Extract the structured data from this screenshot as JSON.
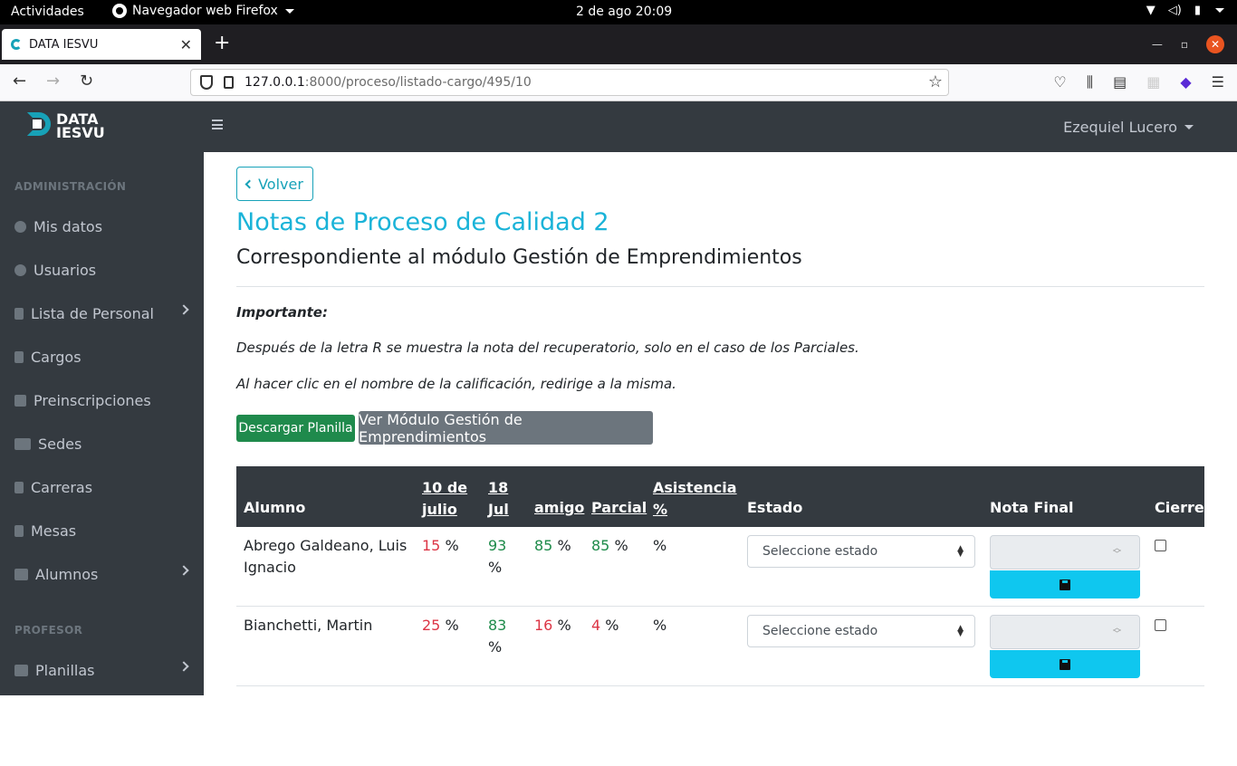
{
  "gnome": {
    "activities": "Actividades",
    "app_name": "Navegador web Firefox",
    "clock": "2 de ago  20:09"
  },
  "browser": {
    "tab_title": "DATA IESVU",
    "url_host": "127.0.0.1",
    "url_path": ":8000/proceso/listado-cargo/495/10"
  },
  "brand": {
    "line1": "DATA",
    "line2": "IESVU"
  },
  "sidebar": {
    "header_admin": "ADMINISTRACIÓN",
    "header_prof": "PROFESOR",
    "items": [
      {
        "label": "Mis datos",
        "icon": "user-circle-icon"
      },
      {
        "label": "Usuarios",
        "icon": "users-icon"
      },
      {
        "label": "Lista de Personal",
        "icon": "clipboard-icon"
      },
      {
        "label": "Cargos",
        "icon": "file-icon"
      },
      {
        "label": "Preinscripciones",
        "icon": "id-card-icon"
      },
      {
        "label": "Sedes",
        "icon": "building-icon"
      },
      {
        "label": "Carreras",
        "icon": "building-alt-icon"
      },
      {
        "label": "Mesas",
        "icon": "file-alt-icon"
      },
      {
        "label": "Alumnos",
        "icon": "table-icon"
      },
      {
        "label": "Planillas",
        "icon": "table-icon"
      }
    ]
  },
  "header": {
    "user": "Ezequiel Lucero"
  },
  "main": {
    "back_label": "Volver",
    "title": "Notas de Proceso de Calidad 2",
    "subtitle": "Correspondiente al módulo Gestión de Emprendimientos",
    "important": "Importante:",
    "note1": "Después de la letra R se muestra la nota del recuperatorio, solo en el caso de los Parciales.",
    "note2": "Al hacer clic en el nombre de la calificación, redirige a la misma.",
    "download_label": "Descargar Planilla",
    "module_label": "Ver Módulo Gestión de Emprendimientos"
  },
  "table": {
    "headers": {
      "alumno": "Alumno",
      "c1_a": "10 de",
      "c1_b": "julio",
      "c2_a": "18",
      "c2_b": "Jul",
      "c3": "amigo",
      "c4": "Parcial",
      "c5_a": "Asistencia",
      "c5_b": "%",
      "estado": "Estado",
      "nota": "Nota Final",
      "cierre": "Cierre"
    },
    "rows": [
      {
        "name_a": "Abrego Galdeano, Luis",
        "name_b": "Ignacio",
        "v1": "15",
        "v2": "93",
        "v3": "85",
        "v4": "85",
        "pct": "%",
        "estado": "Seleccione estado"
      },
      {
        "name_a": "Bianchetti, Martin",
        "name_b": "",
        "v1": "25",
        "v2": "83",
        "v3": "16",
        "v4": "4",
        "pct": "%",
        "estado": "Seleccione estado"
      }
    ]
  },
  "colors": {
    "accent": "#17a2b8",
    "sidebar": "#343a40",
    "pass": "#1e8b4a",
    "fail": "#dc3545",
    "save": "#0fc7ef"
  }
}
